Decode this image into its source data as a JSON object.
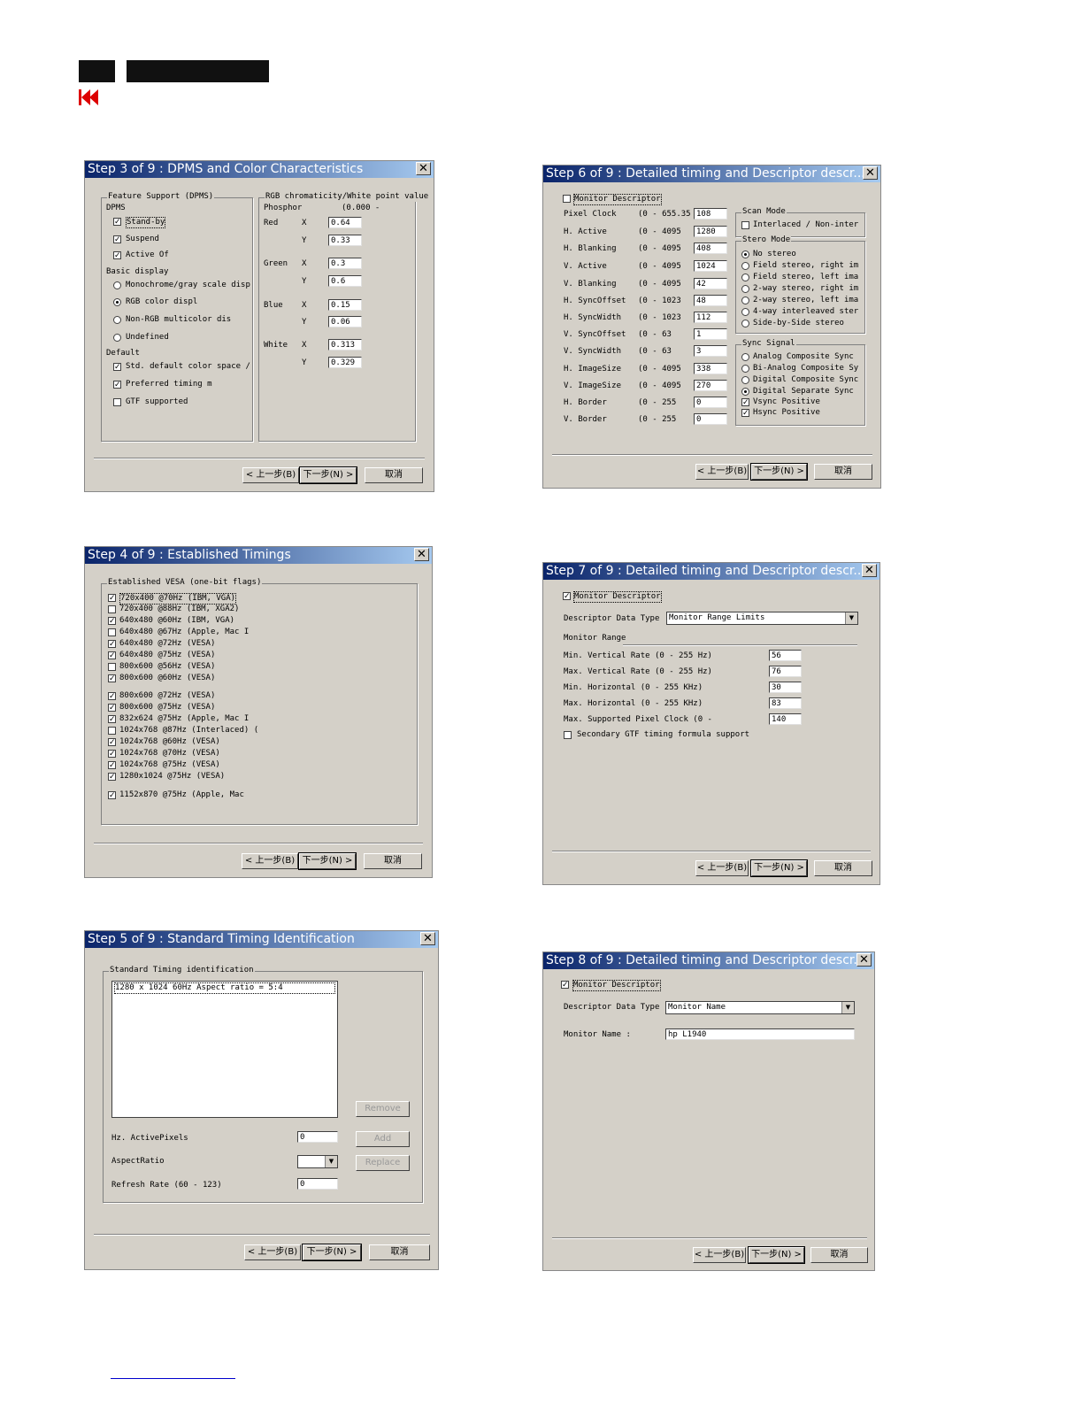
{
  "header": {
    "nav_icon": "rewind-double-arrow-icon"
  },
  "buttons": {
    "back": "< 上一步(B)",
    "next": "下一步(N) >",
    "cancel": "取消"
  },
  "s3": {
    "title": "Step 3 of 9 : DPMS and Color Characteristics",
    "fs": "Feature Support (DPMS)",
    "dpms": "DPMS",
    "standby": "Stand-by",
    "suspend": "Suspend",
    "activeoff": "Active Of",
    "basic": "Basic display",
    "mono": "Monochrome/gray scale disp",
    "rgb": "RGB color displ",
    "nonrgb": "Non-RGB multicolor dis",
    "undef": "Undefined",
    "default": "Default",
    "std": "Std. default color space /",
    "pref": "Preferred timing m",
    "gtf": "GTF supported",
    "rgbgrp": "RGB chromaticity/White point value",
    "phosphor": "Phosphor",
    "range": "(0.000 -",
    "red": "Red",
    "green": "Green",
    "blue": "Blue",
    "white": "White",
    "x": "X",
    "y": "Y",
    "rx": "0.64",
    "ry": "0.33",
    "gx": "0.3",
    "gy": "0.6",
    "bx": "0.15",
    "by": "0.06",
    "wx": "0.313",
    "wy": "0.329"
  },
  "s4": {
    "title": "Step 4 of 9 : Established Timings",
    "grp": "Established VESA (one-bit flags)",
    "items": [
      {
        "label": "720x400 @70Hz (IBM, VGA)",
        "mark": "✓"
      },
      {
        "label": "720x400 @88Hz (IBM, XGA2)",
        "mark": ""
      },
      {
        "label": "640x480 @60Hz (IBM, VGA)",
        "mark": "✓"
      },
      {
        "label": "640x480 @67Hz (Apple, Mac I",
        "mark": ""
      },
      {
        "label": "640x480 @72Hz (VESA)",
        "mark": "✓"
      },
      {
        "label": "640x480 @75Hz (VESA)",
        "mark": "✓"
      },
      {
        "label": "800x600 @56Hz (VESA)",
        "mark": ""
      },
      {
        "label": "800x600 @60Hz (VESA)",
        "mark": "✓"
      },
      {
        "label": "800x600 @72Hz (VESA)",
        "mark": "✓"
      },
      {
        "label": "800x600 @75Hz (VESA)",
        "mark": "✓"
      },
      {
        "label": "832x624 @75Hz (Apple, Mac I",
        "mark": "✓"
      },
      {
        "label": "1024x768 @87Hz (Interlaced) (",
        "mark": ""
      },
      {
        "label": "1024x768 @60Hz (VESA)",
        "mark": "✓"
      },
      {
        "label": "1024x768 @70Hz (VESA)",
        "mark": "✓"
      },
      {
        "label": "1024x768 @75Hz (VESA)",
        "mark": "✓"
      },
      {
        "label": "1280x1024 @75Hz (VESA)",
        "mark": "✓"
      },
      {
        "label": "1152x870 @75Hz (Apple, Mac",
        "mark": "✓"
      }
    ]
  },
  "s5": {
    "title": "Step 5 of 9 : Standard Timing Identification",
    "grp": "Standard Timing identification",
    "entry": "1280 x 1024      60Hz    Aspect ratio =  5:4",
    "remove": "Remove",
    "add": "Add",
    "replace": "Replace",
    "hz": "Hz. ActivePixels",
    "hzv": "0",
    "aspect": "AspectRatio",
    "refresh": "Refresh Rate (60 - 123)",
    "refv": "0"
  },
  "s6": {
    "title": "Step 6 of 9 : Detailed timing and Descriptor descr...",
    "md": "Monitor Descriptor",
    "rows": [
      {
        "label": "Pixel Clock",
        "range": "(0 - 655.35",
        "value": "108"
      },
      {
        "label": "H. Active",
        "range": "(0 - 4095",
        "value": "1280"
      },
      {
        "label": "H. Blanking",
        "range": "(0 - 4095",
        "value": "408"
      },
      {
        "label": "V. Active",
        "range": "(0 - 4095",
        "value": "1024"
      },
      {
        "label": "V. Blanking",
        "range": "(0 - 4095",
        "value": "42"
      },
      {
        "label": "H. SyncOffset",
        "range": "(0 - 1023",
        "value": "48"
      },
      {
        "label": "H. SyncWidth",
        "range": "(0 - 1023",
        "value": "112"
      },
      {
        "label": "V. SyncOffset",
        "range": "(0 - 63",
        "value": "1"
      },
      {
        "label": "V. SyncWidth",
        "range": "(0 - 63",
        "value": "3"
      },
      {
        "label": "H. ImageSize",
        "range": "(0 - 4095",
        "value": "338"
      },
      {
        "label": "V. ImageSize",
        "range": "(0 - 4095",
        "value": "270"
      },
      {
        "label": "H. Border",
        "range": "(0 - 255",
        "value": "0"
      },
      {
        "label": "V. Border",
        "range": "(0 - 255",
        "value": "0"
      }
    ],
    "scan": "Scan Mode",
    "interlaced": "Interlaced / Non-inter",
    "stereo": "Stero Mode",
    "stereo_opts": [
      "No stereo",
      "Field stereo, right im",
      "Field stereo, left ima",
      "2-way stereo, right im",
      "2-way stereo, left ima",
      "4-way interleaved ster",
      "Side-by-Side stereo"
    ],
    "sync": "Sync  Signal",
    "sync_opts": [
      "Analog Composite Sync",
      "Bi-Analog Composite Sy",
      "Digital Composite Sync",
      "Digital Separate Sync"
    ],
    "vsync": "Vsync Positive",
    "hsync": "Hsync Positive"
  },
  "s7": {
    "title": "Step 7 of 9 : Detailed timing and Descriptor descr...",
    "md": "Monitor Descriptor",
    "ddt": "Descriptor Data Type",
    "ddt_val": "Monitor Range Limits",
    "mr": "Monitor Range",
    "rows": [
      {
        "label": "Min. Vertical Rate   (0 - 255 Hz)",
        "value": "56"
      },
      {
        "label": "Max. Vertical Rate  (0 - 255 Hz)",
        "value": "76"
      },
      {
        "label": "Min. Horizontal   (0 - 255 KHz)",
        "value": "30"
      },
      {
        "label": "Max. Horizontal   (0 - 255 KHz)",
        "value": "83"
      },
      {
        "label": "Max. Supported Pixel Clock  (0 -",
        "value": "140"
      }
    ],
    "sec": "Secondary GTF timing formula support"
  },
  "s8": {
    "title": "Step 8 of 9 : Detailed timing and Descriptor descr...",
    "md": "Monitor Descriptor",
    "ddt": "Descriptor Data Type",
    "ddt_val": "Monitor Name",
    "mn": "Monitor Name :",
    "mn_val": "hp L1940"
  }
}
